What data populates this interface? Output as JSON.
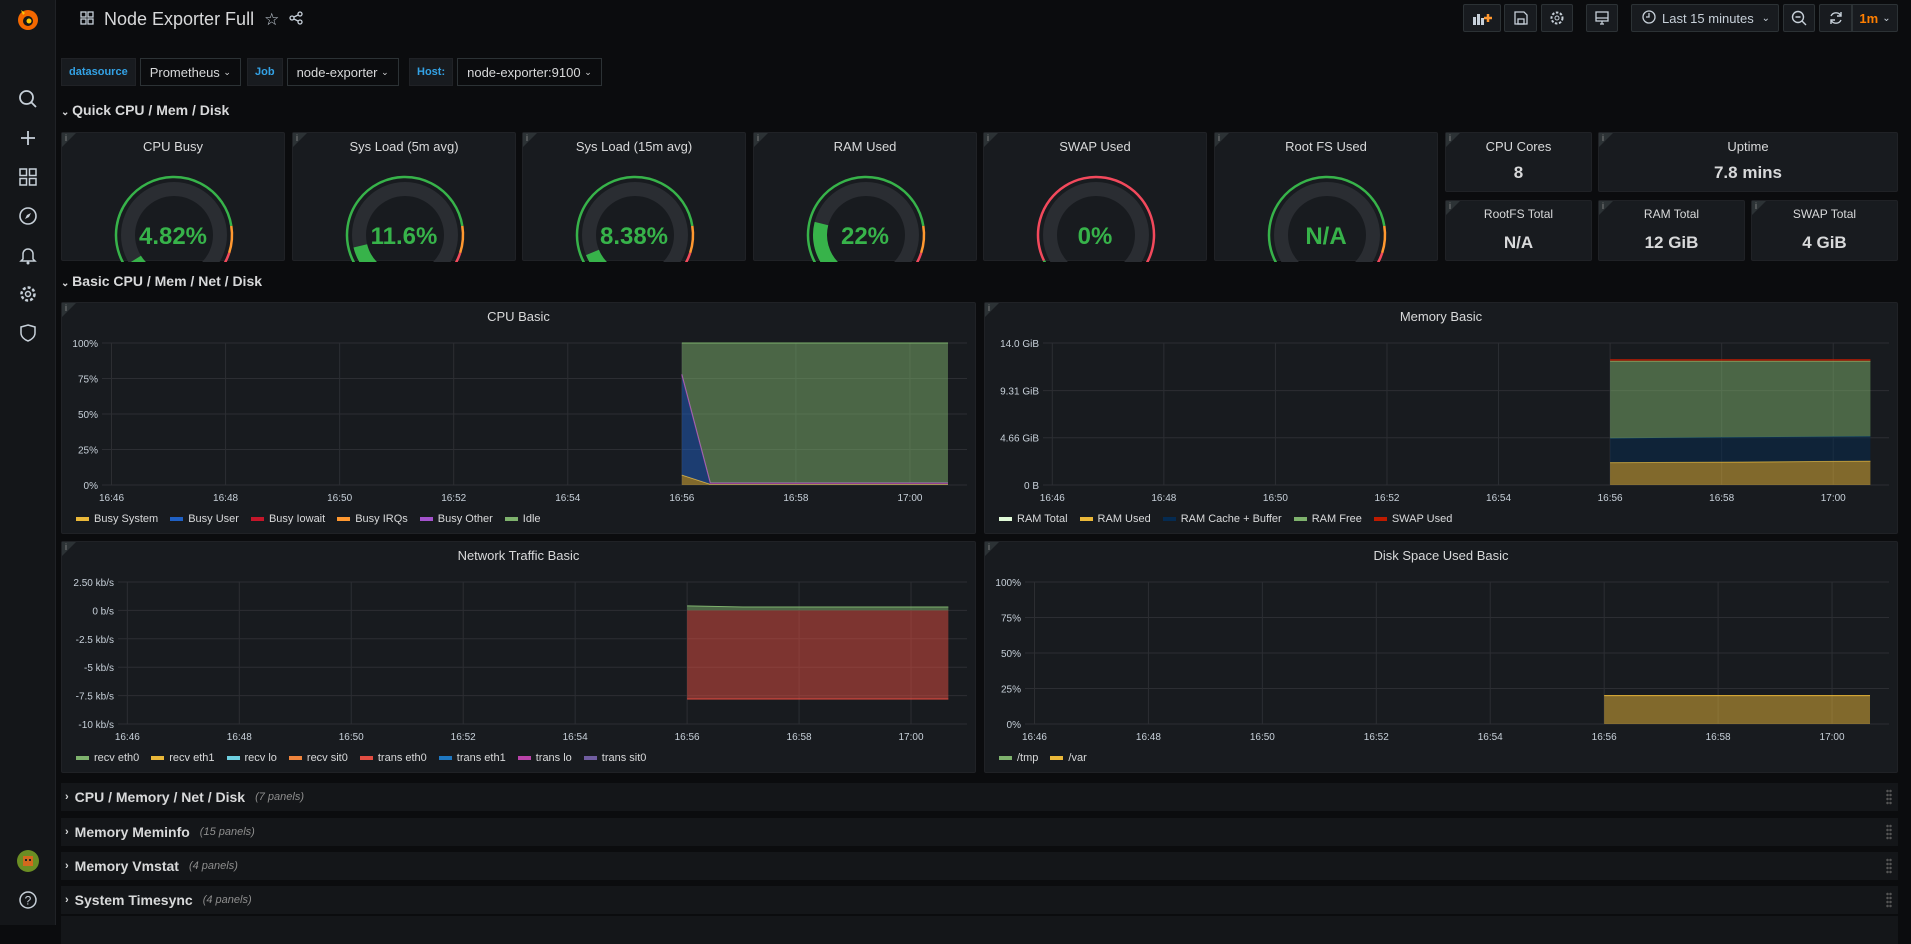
{
  "header": {
    "title": "Node Exporter Full",
    "time_range": "Last 15 minutes",
    "refresh": "1m"
  },
  "colors": {
    "accent": "#f55f3e",
    "green": "#37b34a",
    "orange": "#ff9830",
    "red": "#f2495c",
    "link": "#33a2e5"
  },
  "variables": [
    {
      "label": "datasource",
      "value": "Prometheus"
    },
    {
      "label": "Job",
      "value": "node-exporter"
    },
    {
      "label": "Host:",
      "value": "node-exporter:9100"
    }
  ],
  "rows": {
    "quick": "Quick CPU / Mem / Disk",
    "basic": "Basic CPU / Mem / Net / Disk"
  },
  "gauges": [
    {
      "title": "CPU Busy",
      "value": "4.82%",
      "fraction": 0.048,
      "thresholds": "green-orange-red"
    },
    {
      "title": "Sys Load (5m avg)",
      "value": "11.6%",
      "fraction": 0.116,
      "thresholds": "green-orange-red"
    },
    {
      "title": "Sys Load (15m avg)",
      "value": "8.38%",
      "fraction": 0.084,
      "thresholds": "green-orange-red"
    },
    {
      "title": "RAM Used",
      "value": "22%",
      "fraction": 0.22,
      "thresholds": "green-orange-red"
    },
    {
      "title": "SWAP Used",
      "value": "0%",
      "fraction": 0,
      "thresholds": "red"
    },
    {
      "title": "Root FS Used",
      "value": "N/A",
      "fraction": 0,
      "thresholds": "green-orange-red"
    }
  ],
  "stats": {
    "cpu_cores": {
      "title": "CPU Cores",
      "value": "8"
    },
    "uptime": {
      "title": "Uptime",
      "value": "7.8 mins"
    },
    "rootfs_total": {
      "title": "RootFS Total",
      "value": "N/A"
    },
    "ram_total": {
      "title": "RAM Total",
      "value": "12 GiB"
    },
    "swap_total": {
      "title": "SWAP Total",
      "value": "4 GiB"
    }
  },
  "charts": [
    {
      "title": "CPU Basic",
      "type": "area",
      "stacked": true,
      "x_ticks": [
        "16:46",
        "16:48",
        "16:50",
        "16:52",
        "16:54",
        "16:56",
        "16:58",
        "17:00"
      ],
      "xlim": [
        "16:45:50",
        "17:01:00"
      ],
      "ylim": [
        0,
        100
      ],
      "y_ticks": [
        0,
        25,
        50,
        75,
        100
      ],
      "y_tick_labels": [
        "0%",
        "25%",
        "50%",
        "75%",
        "100%"
      ],
      "x": [
        "16:56:00",
        "16:56:30",
        "16:58:00",
        "17:00:40"
      ],
      "series": [
        {
          "name": "Busy System",
          "color": "#eab839",
          "values": [
            7,
            0.5,
            0.5,
            0.5
          ]
        },
        {
          "name": "Busy User",
          "color": "#1f60c4",
          "values": [
            70,
            0.5,
            0.5,
            0.5
          ]
        },
        {
          "name": "Busy Iowait",
          "color": "#c4162a",
          "values": [
            0.5,
            0.2,
            0.2,
            0.2
          ]
        },
        {
          "name": "Busy IRQs",
          "color": "#ff9830",
          "values": [
            0,
            0,
            0,
            0
          ]
        },
        {
          "name": "Busy Other",
          "color": "#a352cc",
          "values": [
            0.5,
            0.3,
            0.3,
            0.3
          ]
        },
        {
          "name": "Idle",
          "color": "#7eb26d",
          "values": [
            22,
            98.5,
            98.5,
            98.5
          ]
        }
      ]
    },
    {
      "title": "Memory Basic",
      "type": "area",
      "stacked": true,
      "x_ticks": [
        "16:46",
        "16:48",
        "16:50",
        "16:52",
        "16:54",
        "16:56",
        "16:58",
        "17:00"
      ],
      "xlim": [
        "16:45:50",
        "17:01:00"
      ],
      "ylim": [
        0,
        14
      ],
      "y_ticks": [
        0,
        4.66,
        9.31,
        14
      ],
      "y_tick_labels": [
        "0 B",
        "4.66 GiB",
        "9.31 GiB",
        "14.0 GiB"
      ],
      "x": [
        "16:56:00",
        "16:58:00",
        "17:00:40"
      ],
      "series": [
        {
          "name": "RAM Total",
          "color": "#e0f9d7",
          "values": [
            0,
            0,
            0
          ],
          "hidden_area": true
        },
        {
          "name": "RAM Used",
          "color": "#eab839",
          "values": [
            2.2,
            2.25,
            2.35
          ]
        },
        {
          "name": "RAM Cache + Buffer",
          "color": "#052b51",
          "values": [
            2.4,
            2.45,
            2.45
          ]
        },
        {
          "name": "RAM Free",
          "color": "#7eb26d",
          "values": [
            7.6,
            7.5,
            7.4
          ]
        },
        {
          "name": "SWAP Used",
          "color": "#bf1b00",
          "values": [
            0.15,
            0.15,
            0.15
          ]
        }
      ]
    },
    {
      "title": "Network Traffic Basic",
      "type": "area",
      "stacked": false,
      "x_ticks": [
        "16:46",
        "16:48",
        "16:50",
        "16:52",
        "16:54",
        "16:56",
        "16:58",
        "17:00"
      ],
      "xlim": [
        "16:45:50",
        "17:01:00"
      ],
      "ylim": [
        -10,
        2.5
      ],
      "y_ticks": [
        -10,
        -7.5,
        -5,
        -2.5,
        0,
        2.5
      ],
      "y_tick_labels": [
        "-10 kb/s",
        "-7.5 kb/s",
        "-5 kb/s",
        "-2.5 kb/s",
        "0 b/s",
        "2.50 kb/s"
      ],
      "x": [
        "16:56:00",
        "16:57:00",
        "17:00:40"
      ],
      "series": [
        {
          "name": "recv eth0",
          "color": "#7eb26d",
          "values": [
            0.4,
            0.3,
            0.3
          ]
        },
        {
          "name": "recv eth1",
          "color": "#eab839",
          "values": [
            0,
            0,
            0
          ]
        },
        {
          "name": "recv lo",
          "color": "#6ed0e0",
          "values": [
            0,
            0,
            0
          ]
        },
        {
          "name": "recv sit0",
          "color": "#ef843c",
          "values": [
            0,
            0,
            0
          ]
        },
        {
          "name": "trans eth0",
          "color": "#e24d42",
          "values": [
            -7.8,
            -7.8,
            -7.8
          ]
        },
        {
          "name": "trans eth1",
          "color": "#1f78c1",
          "values": [
            0,
            0,
            0
          ]
        },
        {
          "name": "trans lo",
          "color": "#ba43a9",
          "values": [
            0,
            0,
            0
          ]
        },
        {
          "name": "trans sit0",
          "color": "#705da0",
          "values": [
            0,
            0,
            0
          ]
        }
      ]
    },
    {
      "title": "Disk Space Used Basic",
      "type": "area",
      "stacked": false,
      "x_ticks": [
        "16:46",
        "16:48",
        "16:50",
        "16:52",
        "16:54",
        "16:56",
        "16:58",
        "17:00"
      ],
      "xlim": [
        "16:45:50",
        "17:01:00"
      ],
      "ylim": [
        0,
        100
      ],
      "y_ticks": [
        0,
        25,
        50,
        75,
        100
      ],
      "y_tick_labels": [
        "0%",
        "25%",
        "50%",
        "75%",
        "100%"
      ],
      "x": [
        "16:56:00",
        "17:00:40"
      ],
      "series": [
        {
          "name": "/tmp",
          "color": "#7eb26d",
          "values": [
            0,
            0
          ]
        },
        {
          "name": "/var",
          "color": "#eab839",
          "values": [
            20,
            20
          ]
        }
      ]
    }
  ],
  "collapsed_rows": [
    {
      "title": "CPU / Memory / Net / Disk",
      "count": "(7 panels)"
    },
    {
      "title": "Memory Meminfo",
      "count": "(15 panels)"
    },
    {
      "title": "Memory Vmstat",
      "count": "(4 panels)"
    },
    {
      "title": "System Timesync",
      "count": "(4 panels)"
    }
  ]
}
